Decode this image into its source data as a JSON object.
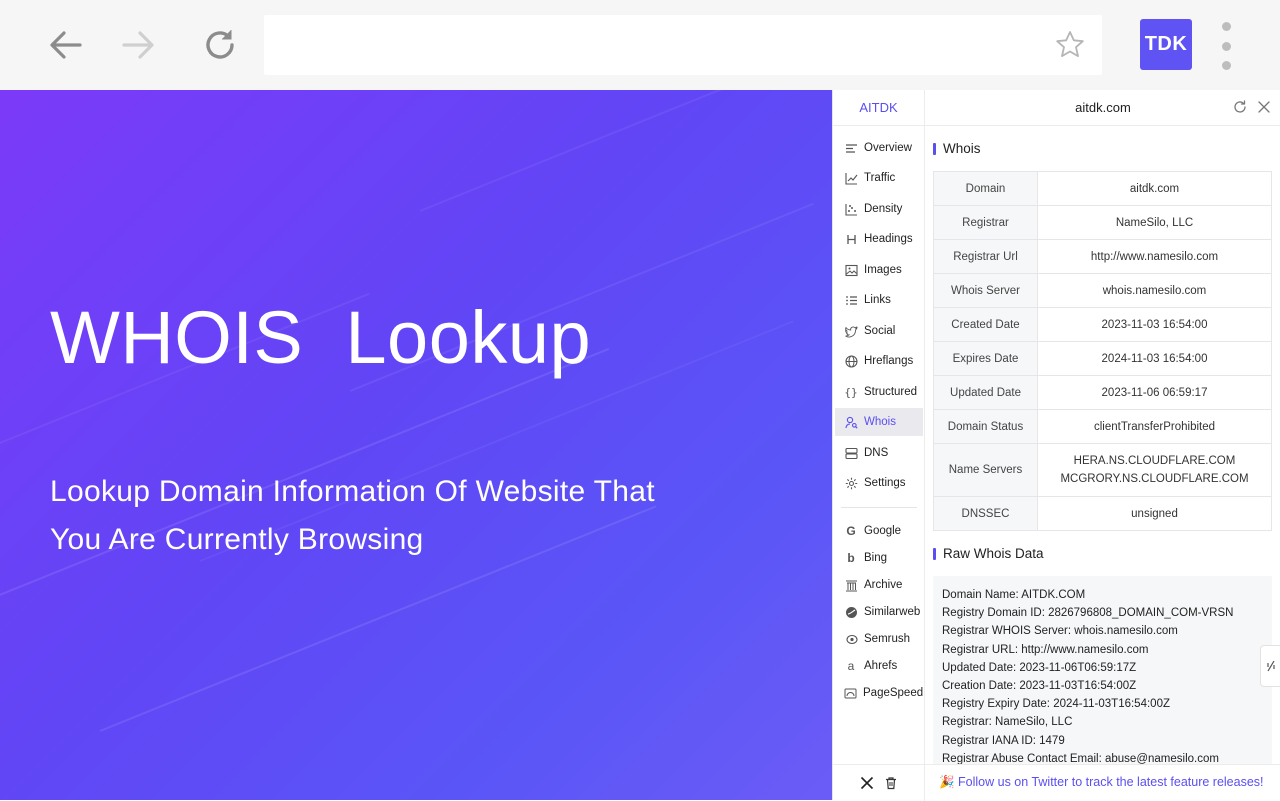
{
  "browser": {
    "extension_label": "TDK"
  },
  "hero": {
    "title": "WHOIS  Lookup",
    "subtitle_line1": "Lookup Domain Information Of Website That",
    "subtitle_line2": "You Are Currently Browsing"
  },
  "panel": {
    "brand": "AITDK",
    "domain": "aitdk.com",
    "nav": [
      {
        "label": "Overview",
        "icon": "overview-icon"
      },
      {
        "label": "Traffic",
        "icon": "traffic-icon"
      },
      {
        "label": "Density",
        "icon": "density-icon"
      },
      {
        "label": "Headings",
        "icon": "headings-icon"
      },
      {
        "label": "Images",
        "icon": "images-icon"
      },
      {
        "label": "Links",
        "icon": "links-icon"
      },
      {
        "label": "Social",
        "icon": "twitter-bird-icon"
      },
      {
        "label": "Hreflangs",
        "icon": "globe-icon"
      },
      {
        "label": "Structured",
        "icon": "braces-icon"
      },
      {
        "label": "Whois",
        "icon": "user-search-icon"
      },
      {
        "label": "DNS",
        "icon": "server-icon"
      },
      {
        "label": "Settings",
        "icon": "gear-icon"
      }
    ],
    "tools": [
      {
        "label": "Google",
        "icon": "google-icon"
      },
      {
        "label": "Bing",
        "icon": "bing-icon"
      },
      {
        "label": "Archive",
        "icon": "archive-icon"
      },
      {
        "label": "Similarweb",
        "icon": "similarweb-icon"
      },
      {
        "label": "Semrush",
        "icon": "semrush-icon"
      },
      {
        "label": "Ahrefs",
        "icon": "ahrefs-icon"
      },
      {
        "label": "PageSpeed",
        "icon": "pagespeed-icon"
      }
    ],
    "active_nav": "Whois",
    "whois_title": "Whois",
    "whois_rows": [
      {
        "key": "Domain",
        "value": "aitdk.com"
      },
      {
        "key": "Registrar",
        "value": "NameSilo, LLC"
      },
      {
        "key": "Registrar Url",
        "value": "http://www.namesilo.com"
      },
      {
        "key": "Whois Server",
        "value": "whois.namesilo.com"
      },
      {
        "key": "Created Date",
        "value": "2023-11-03 16:54:00"
      },
      {
        "key": "Expires Date",
        "value": "2024-11-03 16:54:00"
      },
      {
        "key": "Updated Date",
        "value": "2023-11-06 06:59:17"
      },
      {
        "key": "Domain Status",
        "value": "clientTransferProhibited"
      },
      {
        "key": "Name Servers",
        "value": "HERA.NS.CLOUDFLARE.COM",
        "value2": "MCGRORY.NS.CLOUDFLARE.COM"
      },
      {
        "key": "DNSSEC",
        "value": "unsigned"
      }
    ],
    "raw_title": "Raw Whois Data",
    "raw_lines": [
      "Domain Name: AITDK.COM",
      "Registry Domain ID: 2826796808_DOMAIN_COM-VRSN",
      "Registrar WHOIS Server: whois.namesilo.com",
      "Registrar URL: http://www.namesilo.com",
      "Updated Date: 2023-11-06T06:59:17Z",
      "Creation Date: 2023-11-03T16:54:00Z",
      "Registry Expiry Date: 2024-11-03T16:54:00Z",
      "Registrar: NameSilo, LLC",
      "Registrar IANA ID: 1479",
      "Registrar Abuse Contact Email: abuse@namesilo.com"
    ],
    "footer_text": "🎉 Follow us on Twitter to track the latest feature releases!"
  },
  "colors": {
    "accent": "#5b4ff0",
    "hero_start": "#7b3af8",
    "hero_end": "#5a55f7"
  }
}
